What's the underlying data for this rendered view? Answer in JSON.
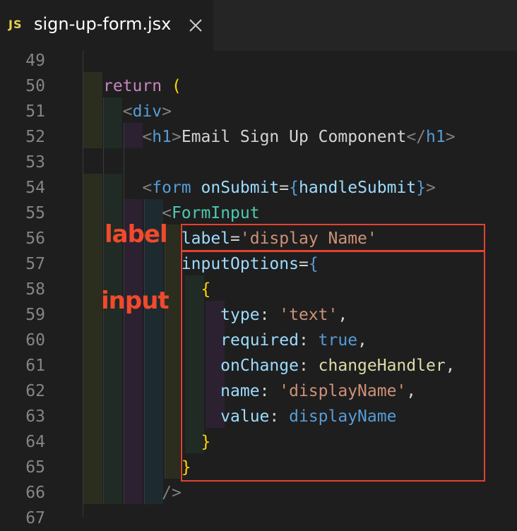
{
  "tab": {
    "icon": "JS",
    "title": "sign-up-form.jsx",
    "close_icon": "close-icon"
  },
  "colors": {
    "annotation": "#e5412f",
    "keyword": "#c586c0",
    "tag": "#569cd6",
    "component": "#4ec9b0",
    "attribute": "#9cdcfe",
    "string": "#ce9178",
    "function": "#dcdcaa"
  },
  "annotations": {
    "label": "label",
    "input": "input"
  },
  "lines": [
    {
      "n": "49",
      "tokens": []
    },
    {
      "n": "50",
      "tokens": [
        [
          "kw",
          "return"
        ],
        [
          "plain",
          " "
        ],
        [
          "br1",
          "("
        ]
      ]
    },
    {
      "n": "51",
      "tokens": [
        [
          "plain",
          "  "
        ],
        [
          "tagp",
          "<"
        ],
        [
          "tag",
          "div"
        ],
        [
          "tagp",
          ">"
        ]
      ]
    },
    {
      "n": "52",
      "tokens": [
        [
          "plain",
          "    "
        ],
        [
          "tagp",
          "<"
        ],
        [
          "tag",
          "h1"
        ],
        [
          "tagp",
          ">"
        ],
        [
          "plain",
          "Email Sign Up Component"
        ],
        [
          "tagp",
          "</"
        ],
        [
          "tag",
          "h1"
        ],
        [
          "tagp",
          ">"
        ]
      ]
    },
    {
      "n": "53",
      "tokens": []
    },
    {
      "n": "54",
      "tokens": [
        [
          "plain",
          "    "
        ],
        [
          "tagp",
          "<"
        ],
        [
          "tag",
          "form"
        ],
        [
          "plain",
          " "
        ],
        [
          "attr",
          "onSubmit"
        ],
        [
          "plain",
          "="
        ],
        [
          "jsbr",
          "{"
        ],
        [
          "attr",
          "handleSubmit"
        ],
        [
          "jsbr",
          "}"
        ],
        [
          "tagp",
          ">"
        ]
      ]
    },
    {
      "n": "55",
      "tokens": [
        [
          "plain",
          "      "
        ],
        [
          "tagp",
          "<"
        ],
        [
          "comp",
          "FormInput"
        ]
      ]
    },
    {
      "n": "56",
      "tokens": [
        [
          "plain",
          "        "
        ],
        [
          "attr",
          "label"
        ],
        [
          "plain",
          "="
        ],
        [
          "str",
          "'display Name'"
        ]
      ]
    },
    {
      "n": "57",
      "tokens": [
        [
          "plain",
          "        "
        ],
        [
          "attr",
          "inputOptions"
        ],
        [
          "plain",
          "="
        ],
        [
          "jsbr",
          "{"
        ]
      ]
    },
    {
      "n": "58",
      "tokens": [
        [
          "plain",
          "          "
        ],
        [
          "br1",
          "{"
        ]
      ]
    },
    {
      "n": "59",
      "tokens": [
        [
          "plain",
          "            "
        ],
        [
          "attr",
          "type"
        ],
        [
          "plain",
          ": "
        ],
        [
          "str",
          "'text'"
        ],
        [
          "plain",
          ","
        ]
      ]
    },
    {
      "n": "60",
      "tokens": [
        [
          "plain",
          "            "
        ],
        [
          "attr",
          "required"
        ],
        [
          "plain",
          ": "
        ],
        [
          "bool",
          "true"
        ],
        [
          "plain",
          ","
        ]
      ]
    },
    {
      "n": "61",
      "tokens": [
        [
          "plain",
          "            "
        ],
        [
          "attr",
          "onChange"
        ],
        [
          "plain",
          ": "
        ],
        [
          "fn",
          "changeHandler"
        ],
        [
          "plain",
          ","
        ]
      ]
    },
    {
      "n": "62",
      "tokens": [
        [
          "plain",
          "            "
        ],
        [
          "attr",
          "name"
        ],
        [
          "plain",
          ": "
        ],
        [
          "str",
          "'displayName'"
        ],
        [
          "plain",
          ","
        ]
      ]
    },
    {
      "n": "63",
      "tokens": [
        [
          "plain",
          "            "
        ],
        [
          "attr",
          "value"
        ],
        [
          "plain",
          ": "
        ],
        [
          "tag",
          "displayName"
        ]
      ]
    },
    {
      "n": "64",
      "tokens": [
        [
          "plain",
          "          "
        ],
        [
          "br1",
          "}"
        ]
      ]
    },
    {
      "n": "65",
      "tokens": [
        [
          "plain",
          "        "
        ],
        [
          "br1",
          "}"
        ]
      ]
    },
    {
      "n": "66",
      "tokens": [
        [
          "plain",
          "      "
        ],
        [
          "tagp",
          "/>"
        ]
      ]
    },
    {
      "n": "67",
      "tokens": []
    }
  ]
}
